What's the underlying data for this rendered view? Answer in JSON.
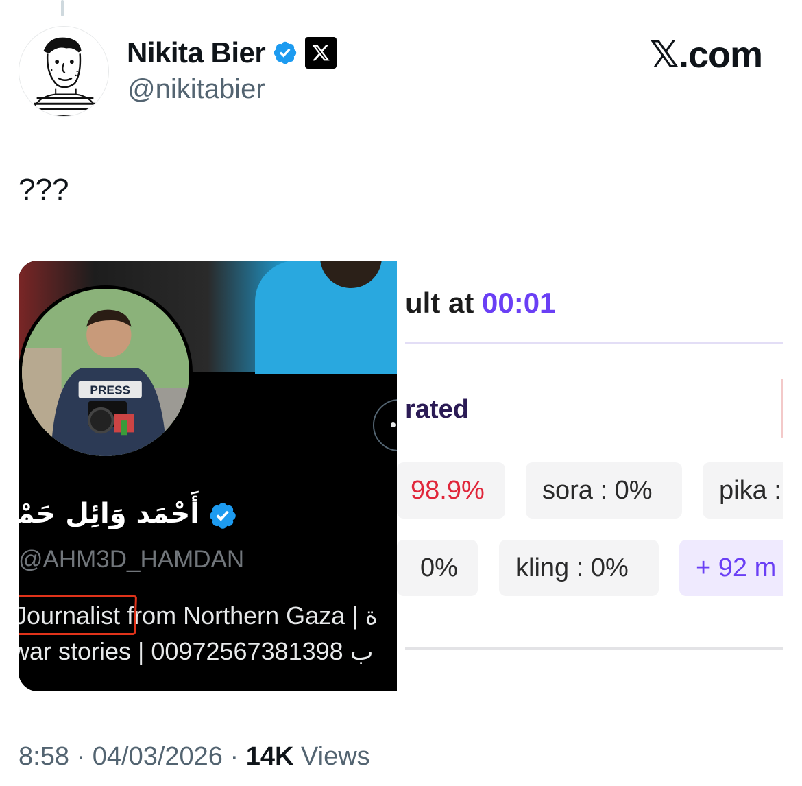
{
  "author": {
    "display_name": "Nikita Bier",
    "handle": "@nikitabier",
    "verified_icon": "verified-badge-icon",
    "affiliate_icon": "x-logo-icon"
  },
  "brand": "𝕏.com",
  "tweet": {
    "text": "???"
  },
  "media": {
    "profile_name": "أَحْمَد وَائِل حَمْدَان",
    "profile_handle": "@AHM3D_HAMDAN",
    "bio_line1": "Journalist from Northern Gaza | ة",
    "bio_line2": "war stories | 00972567381398 ب",
    "press_label": "PRESS"
  },
  "result_panel": {
    "heading_prefix": "ult at ",
    "heading_time": "00:01",
    "rated_label": "rated",
    "pills_row1": [
      {
        "label": "98.9%",
        "style": "red"
      },
      {
        "label": "sora :  0%",
        "style": "default"
      },
      {
        "label": "pika :",
        "style": "default"
      }
    ],
    "pills_row2": [
      {
        "label": "0%",
        "style": "default"
      },
      {
        "label": "kling :  0%",
        "style": "default"
      },
      {
        "label": "+ 92 m",
        "style": "purple"
      }
    ]
  },
  "meta": {
    "time": "8:58",
    "date": "04/03/2026",
    "separator": " · ",
    "views_count": "14K",
    "views_label": " Views"
  },
  "colors": {
    "verified_blue": "#1d9bf0",
    "accent_purple": "#6a3ff5",
    "alert_red": "#e0263a",
    "highlight_red": "#e0331a"
  }
}
